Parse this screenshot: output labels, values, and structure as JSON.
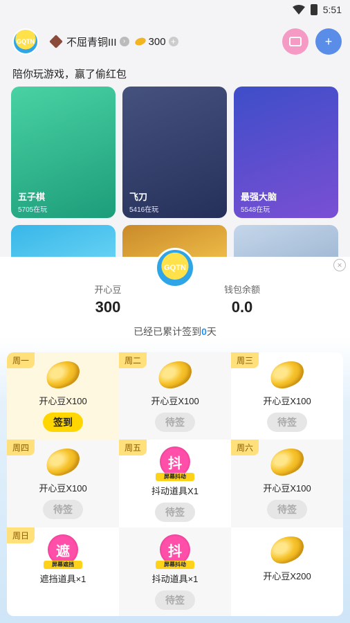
{
  "status": {
    "time": "5:51"
  },
  "header": {
    "rank_text": "不屈青铜III",
    "bean_count": "300"
  },
  "tagline": "陪你玩游戏，赢了偷红包",
  "games": [
    {
      "title": "五子棋",
      "players": "5705在玩"
    },
    {
      "title": "飞刀",
      "players": "5416在玩"
    },
    {
      "title": "最强大脑",
      "players": "5548在玩"
    }
  ],
  "sheet": {
    "logo_text": "GQTN",
    "happy_beans_label": "开心豆",
    "happy_beans_value": "300",
    "wallet_label": "钱包余额",
    "wallet_value": "0.0",
    "streak_prefix": "已经已累计签到",
    "streak_days": "0",
    "streak_suffix": "天"
  },
  "days": [
    {
      "day": "周一",
      "item": "开心豆X100",
      "type": "bean",
      "button": "签到",
      "state": "active"
    },
    {
      "day": "周二",
      "item": "开心豆X100",
      "type": "bean",
      "button": "待签",
      "state": "pending"
    },
    {
      "day": "周三",
      "item": "开心豆X100",
      "type": "bean",
      "button": "待签",
      "state": "pending"
    },
    {
      "day": "周四",
      "item": "开心豆X100",
      "type": "bean",
      "button": "待签",
      "state": "pending"
    },
    {
      "day": "周五",
      "item": "抖动道具X1",
      "type": "shake",
      "icon_char": "抖",
      "band": "屏幕抖动",
      "button": "待签",
      "state": "pending"
    },
    {
      "day": "周六",
      "item": "开心豆X100",
      "type": "bean",
      "button": "待签",
      "state": "pending"
    },
    {
      "day": "周日",
      "item": "遮挡道具×1",
      "type": "block",
      "icon_char": "遮",
      "band": "屏幕遮挡",
      "button": "",
      "state": "none"
    },
    {
      "day": "",
      "item": "抖动道具×1",
      "type": "shake",
      "icon_char": "抖",
      "band": "屏幕抖动",
      "button": "待签",
      "state": "pending"
    },
    {
      "day": "",
      "item": "开心豆X200",
      "type": "bean",
      "button": "",
      "state": "none"
    }
  ]
}
